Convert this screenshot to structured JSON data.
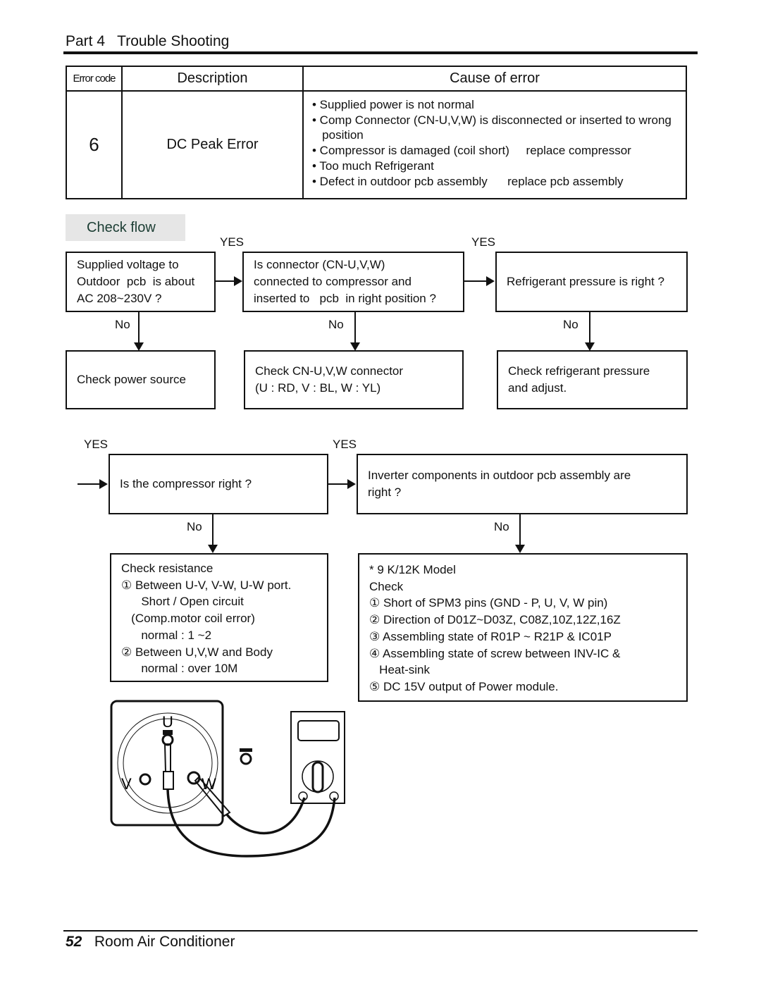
{
  "header": {
    "part": "Part 4",
    "title": "Trouble Shooting"
  },
  "table": {
    "headers": [
      "Error code",
      "Description",
      "Cause of error"
    ],
    "code": "6",
    "description": "DC Peak Error",
    "causes": [
      "• Supplied power is not normal",
      "• Comp Connector (CN-U,V,W) is disconnected or inserted to wrong",
      "   position",
      "• Compressor is damaged (coil short)     replace compressor",
      "• Too much Refrigerant",
      "• Defect in outdoor pcb assembly      replace pcb assembly"
    ]
  },
  "check_flow": {
    "title": "Check flow",
    "yes": "YES",
    "no": "No",
    "q1": [
      "Supplied voltage to",
      "Outdoor  pcb  is about",
      "AC 208~230V ?"
    ],
    "q2": [
      "Is connector (CN-U,V,W)",
      "connected to compressor and",
      "inserted to   pcb  in right position ?"
    ],
    "q3": [
      "Refrigerant pressure is right ?"
    ],
    "a1": [
      "Check power source"
    ],
    "a2": [
      "Check CN-U,V,W connector",
      "(U : RD, V : BL, W : YL)"
    ],
    "a3": [
      "Check refrigerant pressure",
      "and adjust."
    ],
    "q4": [
      "Is the compressor right ?"
    ],
    "q5": [
      "Inverter components in outdoor pcb assembly are",
      "right ?"
    ],
    "a4": [
      "Check resistance",
      "① Between U-V, V-W, U-W port.",
      "      Short / Open circuit",
      "   (Comp.motor coil error)",
      "      normal : 1 ~2",
      "② Between U,V,W and Body",
      "      normal : over 10M"
    ],
    "a5": [
      "* 9 K/12K Model",
      "Check",
      "① Short of SPM3 pins (GND - P, U, V, W pin)",
      "② Direction of D01Z~D03Z, C08Z,10Z,12Z,16Z",
      "③ Assembling state of R01P ~ R21P & IC01P",
      "④ Assembling state of screw between INV-IC &",
      "   Heat-sink",
      "⑤ DC 15V output of Power module."
    ]
  },
  "illustration": {
    "terminals": [
      "U",
      "V",
      "W"
    ]
  },
  "footer": {
    "page": "52",
    "title": "Room Air Conditioner"
  }
}
